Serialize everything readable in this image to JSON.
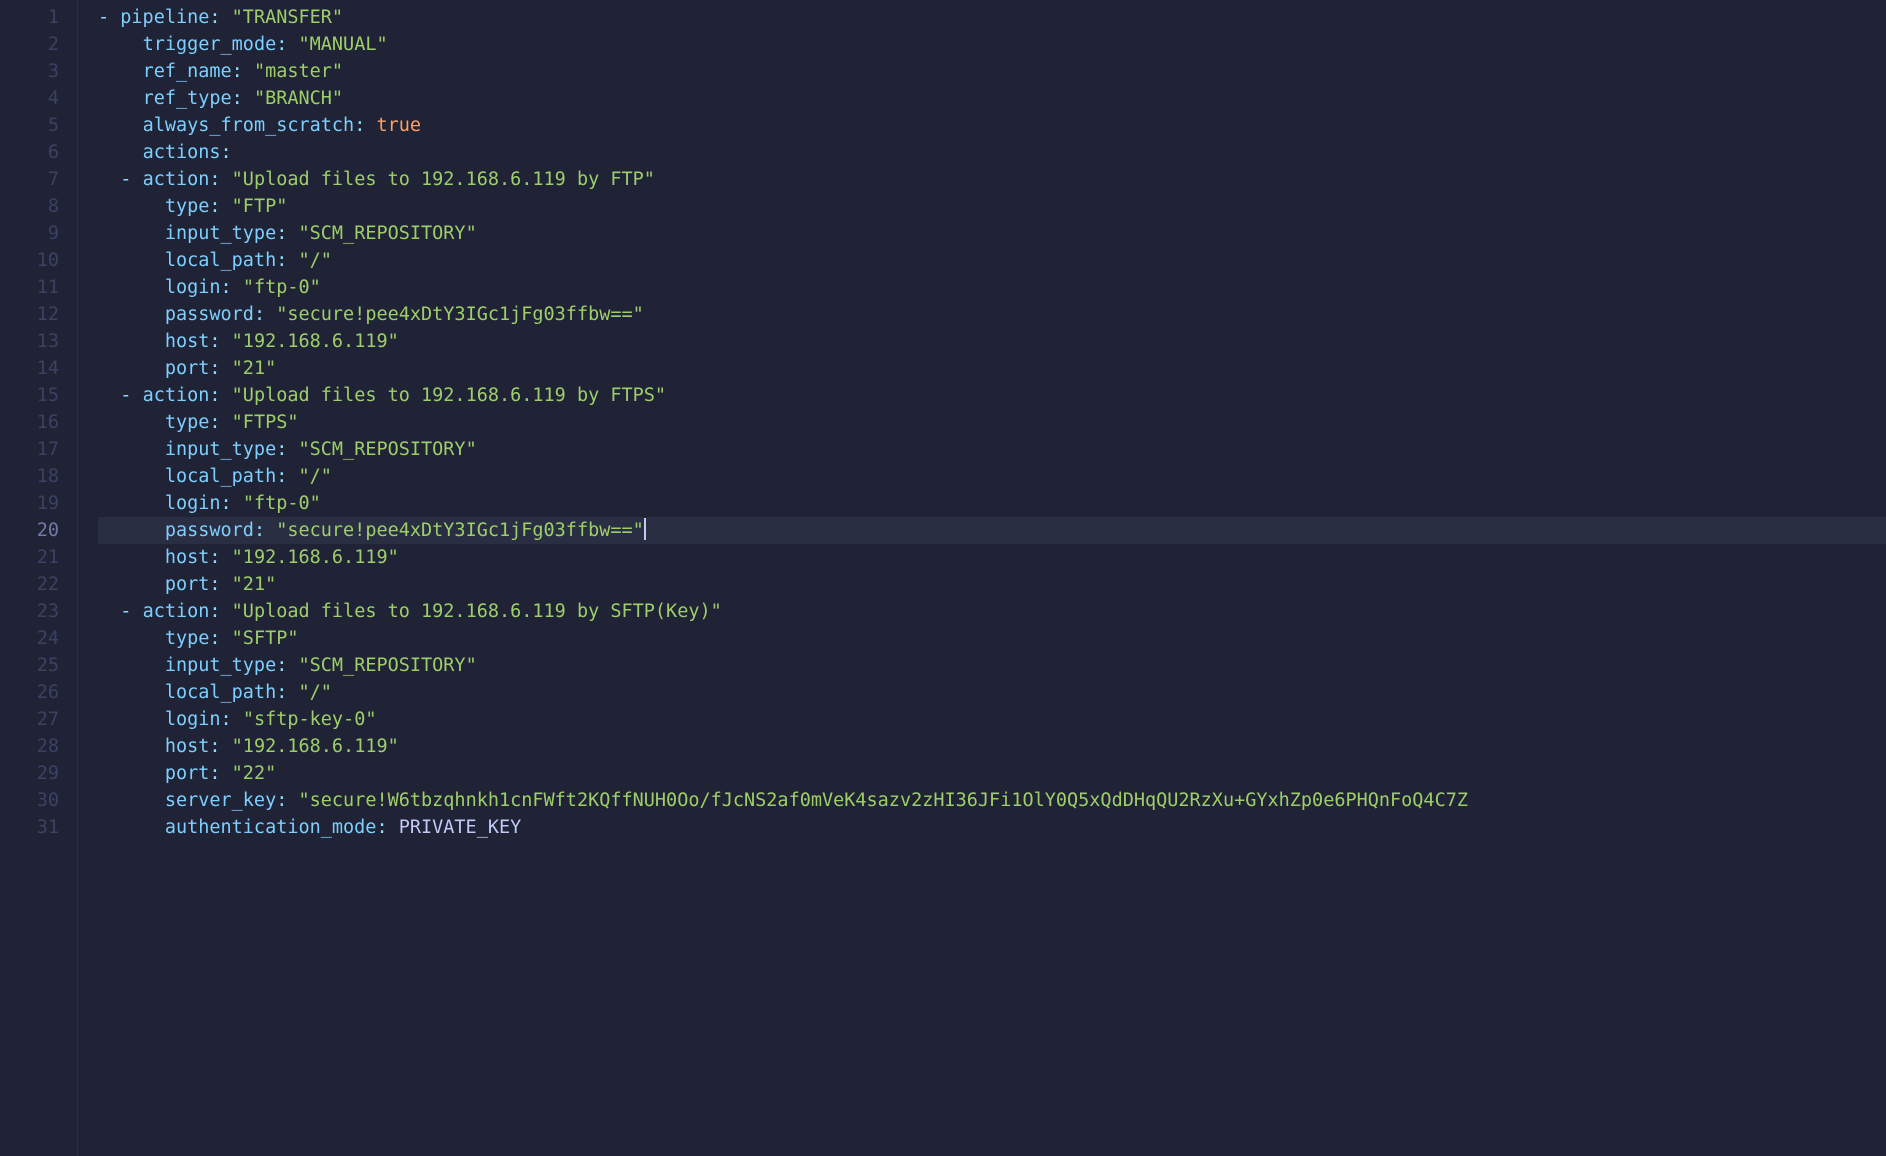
{
  "editor": {
    "activeLine": 20,
    "lines": [
      {
        "num": 1,
        "indent": 0,
        "dash": true,
        "key": "pipeline",
        "type": "str",
        "value": "\"TRANSFER\""
      },
      {
        "num": 2,
        "indent": 1,
        "dash": false,
        "key": "trigger_mode",
        "type": "str",
        "value": "\"MANUAL\""
      },
      {
        "num": 3,
        "indent": 1,
        "dash": false,
        "key": "ref_name",
        "type": "str",
        "value": "\"master\""
      },
      {
        "num": 4,
        "indent": 1,
        "dash": false,
        "key": "ref_type",
        "type": "str",
        "value": "\"BRANCH\""
      },
      {
        "num": 5,
        "indent": 1,
        "dash": false,
        "key": "always_from_scratch",
        "type": "bool",
        "value": "true"
      },
      {
        "num": 6,
        "indent": 1,
        "dash": false,
        "key": "actions",
        "type": "none",
        "value": ""
      },
      {
        "num": 7,
        "indent": 1,
        "dash": true,
        "key": "action",
        "type": "str",
        "value": "\"Upload files to 192.168.6.119 by FTP\""
      },
      {
        "num": 8,
        "indent": 2,
        "dash": false,
        "key": "type",
        "type": "str",
        "value": "\"FTP\""
      },
      {
        "num": 9,
        "indent": 2,
        "dash": false,
        "key": "input_type",
        "type": "str",
        "value": "\"SCM_REPOSITORY\""
      },
      {
        "num": 10,
        "indent": 2,
        "dash": false,
        "key": "local_path",
        "type": "str",
        "value": "\"/\""
      },
      {
        "num": 11,
        "indent": 2,
        "dash": false,
        "key": "login",
        "type": "str",
        "value": "\"ftp-0\""
      },
      {
        "num": 12,
        "indent": 2,
        "dash": false,
        "key": "password",
        "type": "str",
        "value": "\"secure!pee4xDtY3IGc1jFg03ffbw==\""
      },
      {
        "num": 13,
        "indent": 2,
        "dash": false,
        "key": "host",
        "type": "str",
        "value": "\"192.168.6.119\""
      },
      {
        "num": 14,
        "indent": 2,
        "dash": false,
        "key": "port",
        "type": "str",
        "value": "\"21\""
      },
      {
        "num": 15,
        "indent": 1,
        "dash": true,
        "key": "action",
        "type": "str",
        "value": "\"Upload files to 192.168.6.119 by FTPS\""
      },
      {
        "num": 16,
        "indent": 2,
        "dash": false,
        "key": "type",
        "type": "str",
        "value": "\"FTPS\""
      },
      {
        "num": 17,
        "indent": 2,
        "dash": false,
        "key": "input_type",
        "type": "str",
        "value": "\"SCM_REPOSITORY\""
      },
      {
        "num": 18,
        "indent": 2,
        "dash": false,
        "key": "local_path",
        "type": "str",
        "value": "\"/\""
      },
      {
        "num": 19,
        "indent": 2,
        "dash": false,
        "key": "login",
        "type": "str",
        "value": "\"ftp-0\""
      },
      {
        "num": 20,
        "indent": 2,
        "dash": false,
        "key": "password",
        "type": "str",
        "value": "\"secure!pee4xDtY3IGc1jFg03ffbw==\"",
        "cursor": true
      },
      {
        "num": 21,
        "indent": 2,
        "dash": false,
        "key": "host",
        "type": "str",
        "value": "\"192.168.6.119\""
      },
      {
        "num": 22,
        "indent": 2,
        "dash": false,
        "key": "port",
        "type": "str",
        "value": "\"21\""
      },
      {
        "num": 23,
        "indent": 1,
        "dash": true,
        "key": "action",
        "type": "str",
        "value": "\"Upload files to 192.168.6.119 by SFTP(Key)\""
      },
      {
        "num": 24,
        "indent": 2,
        "dash": false,
        "key": "type",
        "type": "str",
        "value": "\"SFTP\""
      },
      {
        "num": 25,
        "indent": 2,
        "dash": false,
        "key": "input_type",
        "type": "str",
        "value": "\"SCM_REPOSITORY\""
      },
      {
        "num": 26,
        "indent": 2,
        "dash": false,
        "key": "local_path",
        "type": "str",
        "value": "\"/\""
      },
      {
        "num": 27,
        "indent": 2,
        "dash": false,
        "key": "login",
        "type": "str",
        "value": "\"sftp-key-0\""
      },
      {
        "num": 28,
        "indent": 2,
        "dash": false,
        "key": "host",
        "type": "str",
        "value": "\"192.168.6.119\""
      },
      {
        "num": 29,
        "indent": 2,
        "dash": false,
        "key": "port",
        "type": "str",
        "value": "\"22\""
      },
      {
        "num": 30,
        "indent": 2,
        "dash": false,
        "key": "server_key",
        "type": "str",
        "value": "\"secure!W6tbzqhnkh1cnFWft2KQffNUH0Oo/fJcNS2af0mVeK4sazv2zHI36JFi1OlY0Q5xQdDHqQU2RzXu+GYxhZp0e6PHQnFoQ4C7Z"
      },
      {
        "num": 31,
        "indent": 2,
        "dash": false,
        "key": "authentication_mode",
        "type": "ident",
        "value": "PRIVATE_KEY"
      }
    ]
  }
}
